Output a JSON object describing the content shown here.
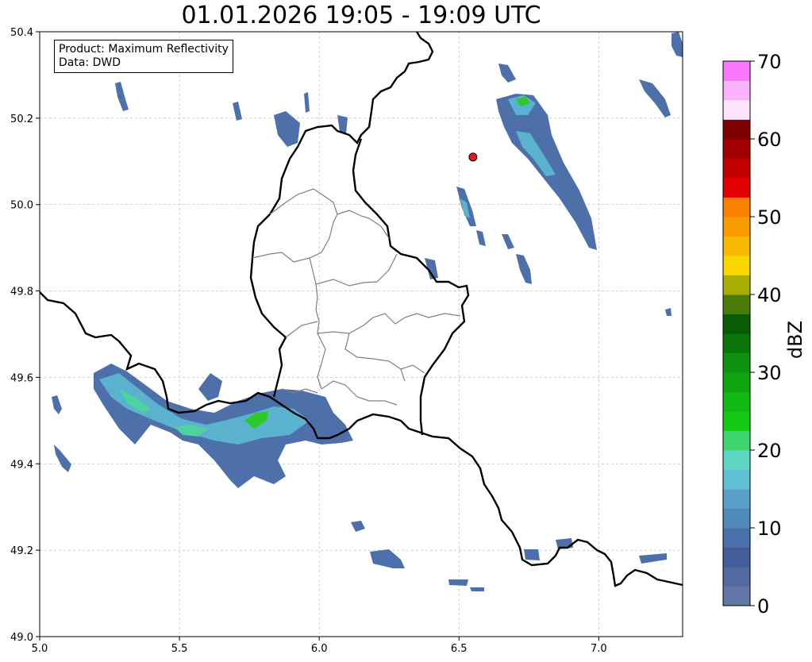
{
  "title": "01.01.2026 19:05 - 19:09 UTC",
  "info": {
    "product": "Product: Maximum Reflectivity",
    "data": "Data: DWD"
  },
  "map": {
    "x_ticks": [
      "5.0",
      "5.5",
      "6.0",
      "6.5",
      "7.0"
    ],
    "y_ticks": [
      "50.4",
      "50.2",
      "50.0",
      "49.8",
      "49.6",
      "49.4",
      "49.2",
      "49.0"
    ],
    "xlim": [
      5.0,
      7.3
    ],
    "ylim": [
      49.0,
      50.4
    ],
    "grid": true,
    "marker": {
      "lon": 6.55,
      "lat": 50.11,
      "color": "#e8171a"
    }
  },
  "colorbar": {
    "unit": "dBZ",
    "range": [
      0,
      70
    ],
    "step": 2.5,
    "tick_labels": [
      "0",
      "10",
      "20",
      "30",
      "40",
      "50",
      "60",
      "70"
    ],
    "colors": [
      "#6175a6",
      "#53699f",
      "#435c9a",
      "#4a70ab",
      "#4f88b9",
      "#58a1c8",
      "#5fbfd5",
      "#5fd5c4",
      "#3ed46e",
      "#14c814",
      "#12b812",
      "#10a510",
      "#0e910e",
      "#0a750a",
      "#085c08",
      "#4a7c07",
      "#a8ae04",
      "#fad600",
      "#f9b800",
      "#f99c00",
      "#f98000",
      "#e40000",
      "#c20000",
      "#a20000",
      "#7f0000",
      "#fde3fd",
      "#fdb2fd",
      "#fd77fd",
      "#f03cf0"
    ]
  }
}
